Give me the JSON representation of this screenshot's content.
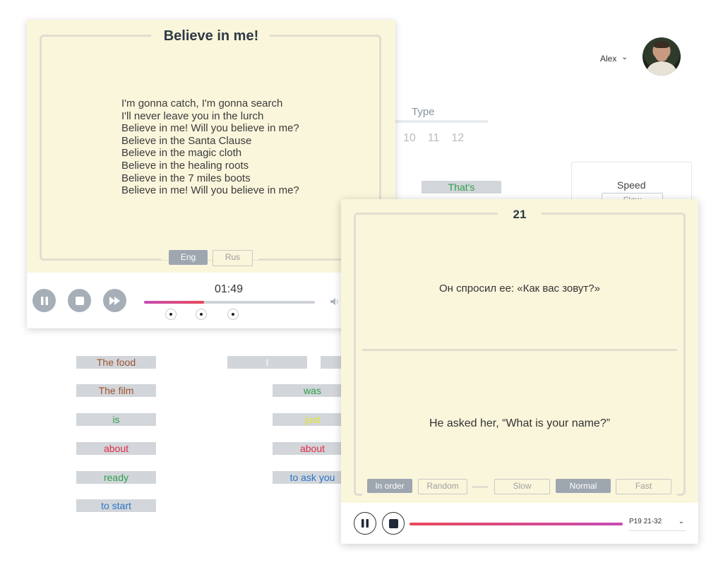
{
  "user": {
    "name": "Alex",
    "chevron": "⌄"
  },
  "bg": {
    "type_label": "Type",
    "numbers": [
      "10",
      "11",
      "12"
    ],
    "thats_chip": "That's",
    "speed_title": "Speed",
    "speed_button": "Slow"
  },
  "words": {
    "left": [
      "The food",
      "The film",
      "is",
      "about",
      "ready",
      "to start"
    ],
    "right": [
      "I",
      "was",
      "just",
      "about",
      "to ask you",
      ""
    ]
  },
  "song": {
    "title": "Believe in me!",
    "lines": [
      "I'm gonna catch, I'm gonna search",
      "I'll never leave you in the lurch",
      "Believe in me! Will you believe in me?",
      "Believe in the Santa Clause",
      "Believe in the magic cloth",
      "Believe in the healing roots",
      "Believe in the 7 miles boots",
      "Believe in me! Will you believe in me?"
    ],
    "lang_eng": "Eng",
    "lang_rus": "Rus",
    "time": "01:49",
    "progress": 0.35
  },
  "phrase": {
    "number": "21",
    "russian": "Он спросил ее: «Как вас зовут?»",
    "english": "He asked her, “What is your name?”",
    "order_in": "In order",
    "order_random": "Random",
    "speed_slow": "Slow",
    "speed_normal": "Normal",
    "speed_fast": "Fast",
    "set_select": "P19 21-32",
    "progress": 1.0
  },
  "colors": {
    "paper": "#faf6dc",
    "chip": "#d2d6da",
    "accent_pink": "#c94bb4",
    "accent_red": "#e8485a"
  }
}
